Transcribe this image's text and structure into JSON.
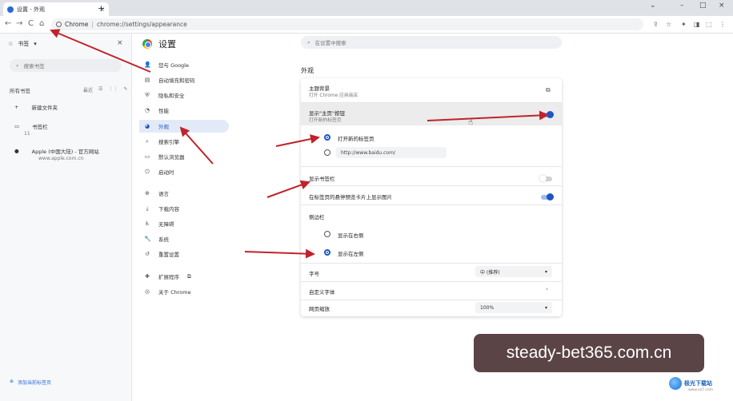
{
  "browser": {
    "tab_title": "设置 - 外观",
    "tab_close": "×",
    "new_tab": "+",
    "window_controls": [
      "⌄",
      "–",
      "□",
      "×"
    ],
    "nav": [
      "←",
      "→",
      "C",
      "⌂"
    ],
    "url_host": "Chrome",
    "url_sep": "|",
    "url_path": "chrome://settings/appearance",
    "toolbar_icons": [
      "⇪",
      "☆",
      "✦",
      "◨",
      "⬚",
      "⋮"
    ]
  },
  "bookmarks_panel": {
    "star": "☆",
    "title": "书签",
    "dropdown": "▾",
    "close": "×",
    "search_icon": "⌕",
    "search_placeholder": "搜索书签",
    "all_label": "所有书签",
    "tool_labels": [
      "最近",
      "☰",
      "⋮⋮",
      "✎"
    ],
    "items": [
      {
        "icon": "+",
        "label": "新建文件夹"
      },
      {
        "icon": "▭",
        "label": "书签栏",
        "count": "11"
      },
      {
        "icon": "●",
        "label": "Apple (中国大陆) - 官方网站",
        "sub": "www.apple.com.cn"
      }
    ],
    "footer_icon": "⊕",
    "footer": "添加当前标签页"
  },
  "settings": {
    "title": "设置",
    "search_icon": "⌕",
    "search_placeholder": "在设置中搜索",
    "nav": [
      {
        "icon": "👤",
        "label": "您与 Google"
      },
      {
        "icon": "▤",
        "label": "自动填充和密码"
      },
      {
        "icon": "⛨",
        "label": "隐私和安全"
      },
      {
        "icon": "◔",
        "label": "性能"
      },
      {
        "icon": "◕",
        "label": "外观",
        "active": true
      },
      {
        "icon": "⌕",
        "label": "搜索引擎"
      },
      {
        "icon": "▭",
        "label": "默认浏览器"
      },
      {
        "icon": "⏻",
        "label": "启动时"
      },
      {
        "icon": "⊕",
        "label": "语言"
      },
      {
        "icon": "⤓",
        "label": "下载内容"
      },
      {
        "icon": "♿",
        "label": "无障碍"
      },
      {
        "icon": "🔧",
        "label": "系统"
      },
      {
        "icon": "↺",
        "label": "重置设置"
      },
      {
        "icon": "✚",
        "label": "扩展程序",
        "extra": "⧉"
      },
      {
        "icon": "◎",
        "label": "关于 Chrome"
      }
    ]
  },
  "appearance": {
    "section_title": "外观",
    "theme_label": "主题背景",
    "theme_sub": "打开 Chrome 应用商店",
    "theme_open_icon": "⧉",
    "home_label": "显示\"主页\"按钮",
    "home_sub": "打开新的标签页",
    "home_toggle_on": true,
    "home_options": [
      "打开新的标签页",
      "http://www.baidu.com/"
    ],
    "home_selected": 0,
    "bookmarks_bar_label": "显示书签栏",
    "bookmarks_bar_on": false,
    "tab_preview_label": "在标签页的悬停预览卡片上显示图片",
    "tab_preview_on": true,
    "side_panel_label": "侧边栏",
    "side_panel_options": [
      "显示在右侧",
      "显示在左侧"
    ],
    "side_panel_selected": 1,
    "font_size_label": "字号",
    "font_size_value": "中 (推荐)",
    "custom_fonts_label": "自定义字体",
    "chevron_right": "›",
    "zoom_label": "网页缩放",
    "zoom_value": "100%",
    "select_arrow": "▾"
  },
  "watermark": {
    "text": "steady-bet365.com.cn",
    "logo_text": "极光下载站",
    "logo_sub": "www.xz7.com"
  },
  "colors": {
    "accent": "#1a56c4",
    "arrow": "#c0232b",
    "watermark_bg": "#5b4446"
  }
}
